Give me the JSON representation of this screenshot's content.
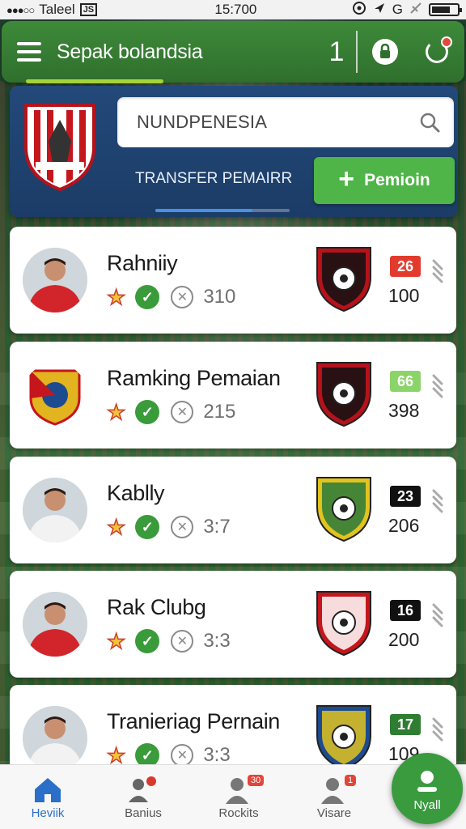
{
  "status_bar": {
    "carrier": "Taleel",
    "carrier_badge": "JS",
    "time": "15:700",
    "indicators": [
      "location-icon",
      "send-icon",
      "G",
      "signal-icon",
      "battery-icon"
    ]
  },
  "header": {
    "title": "Sepak bolandsia",
    "count": "1",
    "icons": [
      "menu-icon",
      "notification-lock-icon",
      "refresh-icon"
    ]
  },
  "top_panel": {
    "search": {
      "value": "NUNDPENESIA",
      "icon": "search-icon"
    },
    "transfer_label": "TRANSFER PEMAIRR",
    "promo_button_label": "Pemioin",
    "progress_fraction": 0.72
  },
  "players": [
    {
      "name": "Rahniiy",
      "stat": "310",
      "badge": "26",
      "badge_color": "#e23b2e",
      "score": "100",
      "jersey": "#d1252b",
      "crest_colors": [
        "#b5121b",
        "#111111"
      ]
    },
    {
      "name": "Ramking Pemaian",
      "stat": "215",
      "badge": "66",
      "badge_color": "#8bd46a",
      "score": "398",
      "jersey": "",
      "crest_colors": [
        "#b5121b",
        "#111111"
      ]
    },
    {
      "name": "Kablly",
      "stat": "3:7",
      "badge": "23",
      "badge_color": "#111111",
      "score": "206",
      "jersey": "#f2f2f2",
      "crest_colors": [
        "#e2c31f",
        "#2a7a3a"
      ]
    },
    {
      "name": "Rak Clubg",
      "stat": "3:3",
      "badge": "16",
      "badge_color": "#111111",
      "score": "200",
      "jersey": "#d1252b",
      "crest_colors": [
        "#c4161c",
        "#ffffff"
      ]
    },
    {
      "name": "Tranieriag Pernain",
      "stat": "3:3",
      "badge": "17",
      "badge_color": "#2f7d32",
      "score": "109",
      "jersey": "#f2f2f2",
      "crest_colors": [
        "#1d4b8f",
        "#e2c31f"
      ]
    }
  ],
  "bottom_nav": [
    {
      "label": "Heviik",
      "icon": "home-icon",
      "badge": ""
    },
    {
      "label": "Banius",
      "icon": "users-icon",
      "badge": ""
    },
    {
      "label": "Rockits",
      "icon": "player-icon",
      "badge": "30"
    },
    {
      "label": "Visare",
      "icon": "profile-icon",
      "badge": "1"
    }
  ],
  "fab": {
    "label": "Nyall",
    "icon": "user-icon"
  }
}
